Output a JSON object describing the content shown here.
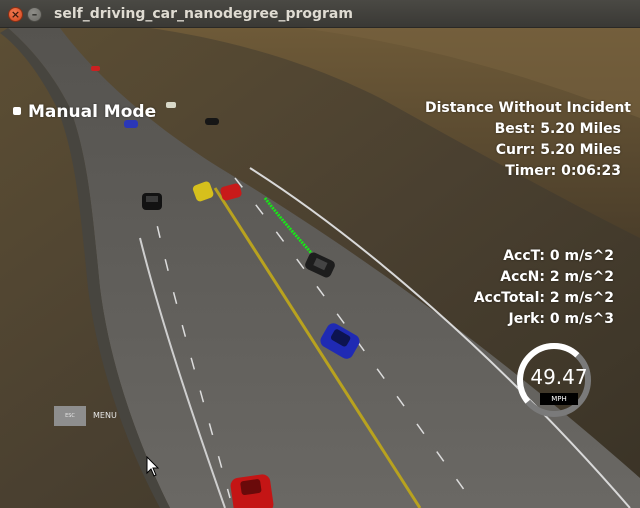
{
  "window": {
    "title": "self_driving_car_nanodegree_program",
    "close_glyph": "×",
    "minimize_glyph": "–"
  },
  "hud": {
    "mode_label": "Manual Mode",
    "distance_title": "Distance Without Incident",
    "best": "Best: 5.20 Miles",
    "curr": "Curr: 5.20 Miles",
    "timer": "Timer: 0:06:23",
    "acc_t": "AccT: 0 m/s^2",
    "acc_n": "AccN: 2 m/s^2",
    "acc_total": "AccTotal: 2 m/s^2",
    "jerk": "Jerk: 0 m/s^3",
    "speed_value": "49.47",
    "speed_unit": "MPH",
    "speed_fraction": 0.62,
    "esc_label": "ESC",
    "menu_label": "MENU"
  },
  "colors": {
    "terrain": "#4a4030",
    "road": "#5f5d58",
    "lane_yellow": "#b8a21f",
    "lane_white": "#d9d9d9",
    "path_green": "#19e619",
    "ego_car": "#1f2ab4",
    "hud_text": "#ffffff"
  },
  "icons": {
    "close": "close-icon",
    "minimize": "minimize-icon",
    "pointer": "mouse-pointer-icon"
  }
}
